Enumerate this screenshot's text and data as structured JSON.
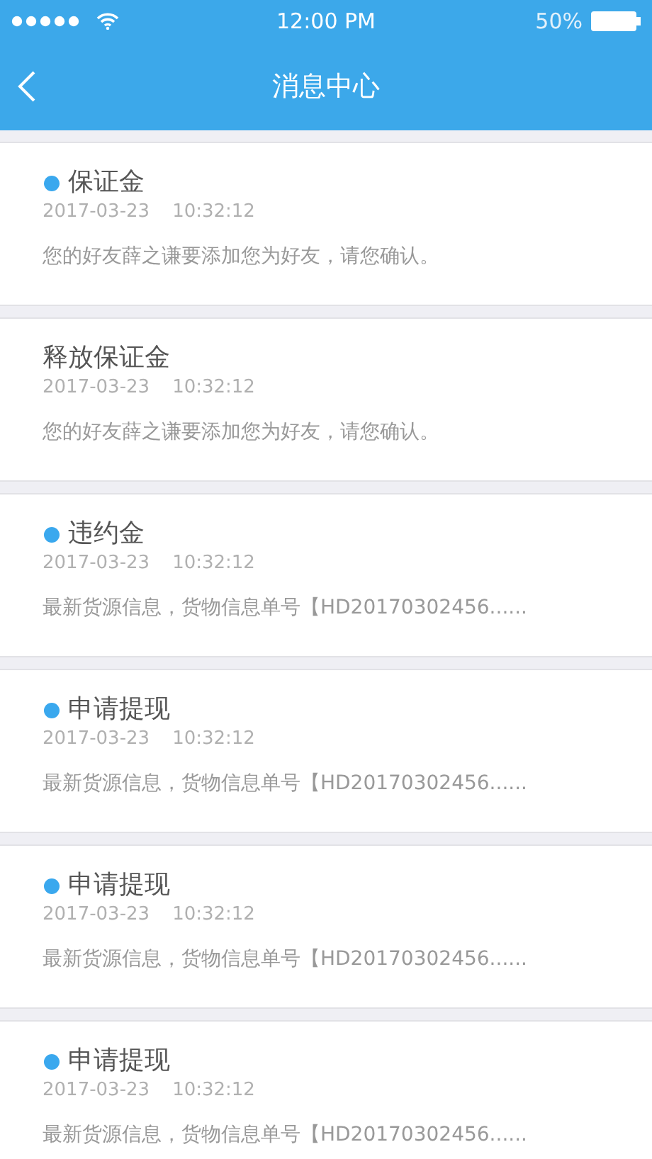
{
  "status_bar": {
    "time": "12:00 PM",
    "battery": "50%"
  },
  "nav": {
    "title": "消息中心"
  },
  "messages": [
    {
      "title": "保证金",
      "unread": true,
      "date": "2017-03-23",
      "time": "10:32:12",
      "body": "您的好友薛之谦要添加您为好友，请您确认。"
    },
    {
      "title": "释放保证金",
      "unread": false,
      "date": "2017-03-23",
      "time": "10:32:12",
      "body": "您的好友薛之谦要添加您为好友，请您确认。"
    },
    {
      "title": "违约金",
      "unread": true,
      "date": "2017-03-23",
      "time": "10:32:12",
      "body": "最新货源信息，货物信息单号【HD20170302456......"
    },
    {
      "title": "申请提现",
      "unread": true,
      "date": "2017-03-23",
      "time": "10:32:12",
      "body": "最新货源信息，货物信息单号【HD20170302456......"
    },
    {
      "title": "申请提现",
      "unread": true,
      "date": "2017-03-23",
      "time": "10:32:12",
      "body": "最新货源信息，货物信息单号【HD20170302456......"
    },
    {
      "title": "申请提现",
      "unread": true,
      "date": "2017-03-23",
      "time": "10:32:12",
      "body": "最新货源信息，货物信息单号【HD20170302456......"
    }
  ]
}
